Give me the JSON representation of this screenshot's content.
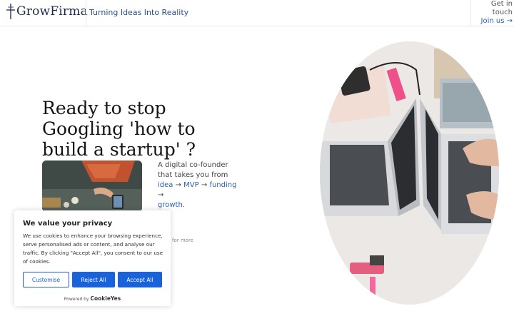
{
  "header": {
    "logo_text": "GrowFirma",
    "tagline": "Turning Ideas Into Reality",
    "cta_line1": "Get in",
    "cta_line2": "touch",
    "join": "Join us →"
  },
  "hero": {
    "headline": "Ready to stop Googling 'how to build a startup' ?",
    "desc_intro": "A digital co-founder that takes you from",
    "desc_idea": "idea",
    "desc_mvp": "MVP",
    "desc_funding": "funding",
    "desc_growth": "growth",
    "arrow": "→",
    "period": ".",
    "more": "for more"
  },
  "cookie_banner": {
    "title": "We value your privacy",
    "body": "We use cookies to enhance your browsing experience, serve personalised ads or content, and analyse our traffic. By clicking \"Accept All\", you consent to our use of cookies.",
    "customise": "Customise",
    "reject": "Reject All",
    "accept": "Accept All",
    "powered_by": "Powered by",
    "brand": "CookieYes"
  },
  "colors": {
    "accent": "#1863dc",
    "tagline": "#2a4f8f"
  }
}
